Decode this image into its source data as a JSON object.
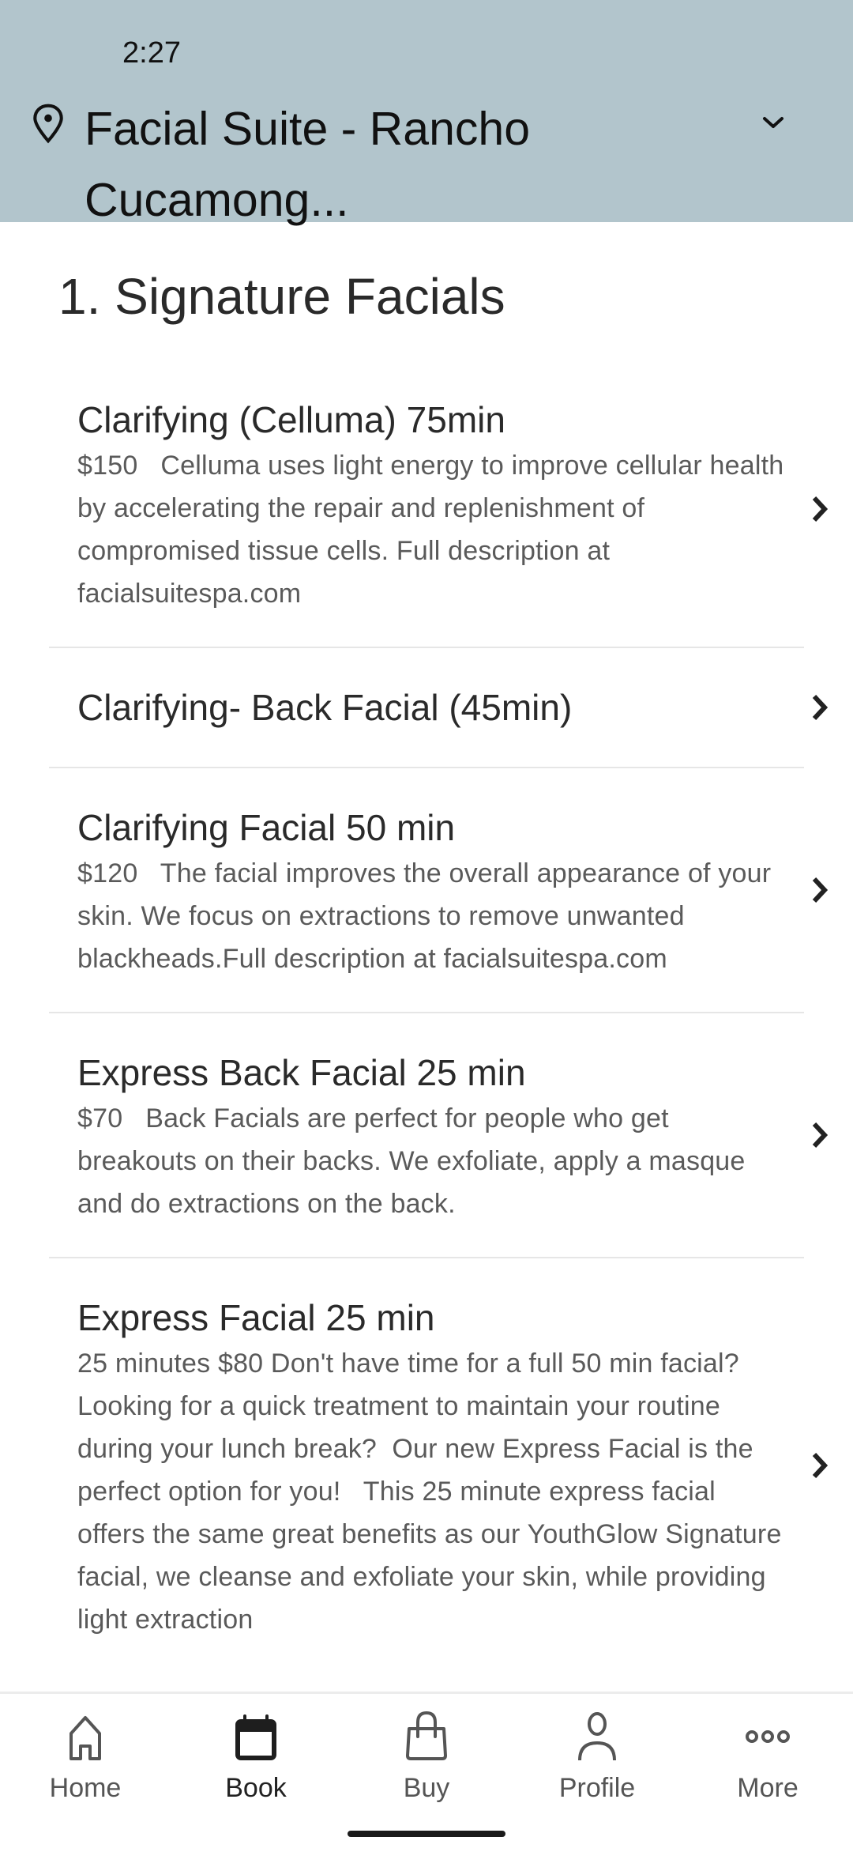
{
  "status_bar": {
    "time": "2:27"
  },
  "header": {
    "location_icon": "map-pin-icon",
    "location_name": "Facial Suite - Rancho Cucamong...",
    "dropdown_icon": "chevron-down-icon",
    "background_color": "#b2c5cc"
  },
  "section": {
    "title": "1. Signature Facials"
  },
  "services": [
    {
      "title": "Clarifying (Celluma) 75min",
      "description": "$150   Celluma uses light energy to improve cellular health by accelerating the repair and replenishment of compromised tissue cells. Full description at facialsuitespa.com"
    },
    {
      "title": "Clarifying- Back Facial (45min)",
      "description": ""
    },
    {
      "title": "Clarifying Facial 50 min",
      "description": "$120   The facial improves the overall appearance of your skin. We focus on extractions to remove unwanted blackheads.Full description at facialsuitespa.com"
    },
    {
      "title": "Express Back Facial 25 min",
      "description": "$70   Back Facials are perfect for people who get breakouts on their backs. We exfoliate, apply a masque and do extractions on the back."
    },
    {
      "title": "Express Facial 25 min",
      "description": "25 minutes $80 Don't have time for a full 50 min facial?  Looking for a quick treatment to maintain your routine during your lunch break?  Our new Express Facial is the perfect option for you!   This 25 minute express facial offers the same great benefits as our YouthGlow Signature facial, we cleanse and exfoliate your skin, while providing light extraction"
    }
  ],
  "nav": {
    "items": [
      {
        "label": "Home",
        "icon": "home-icon",
        "active": false
      },
      {
        "label": "Book",
        "icon": "calendar-icon",
        "active": true
      },
      {
        "label": "Buy",
        "icon": "shopping-bag-icon",
        "active": false
      },
      {
        "label": "Profile",
        "icon": "person-icon",
        "active": false
      },
      {
        "label": "More",
        "icon": "more-dots-icon",
        "active": false
      }
    ]
  }
}
